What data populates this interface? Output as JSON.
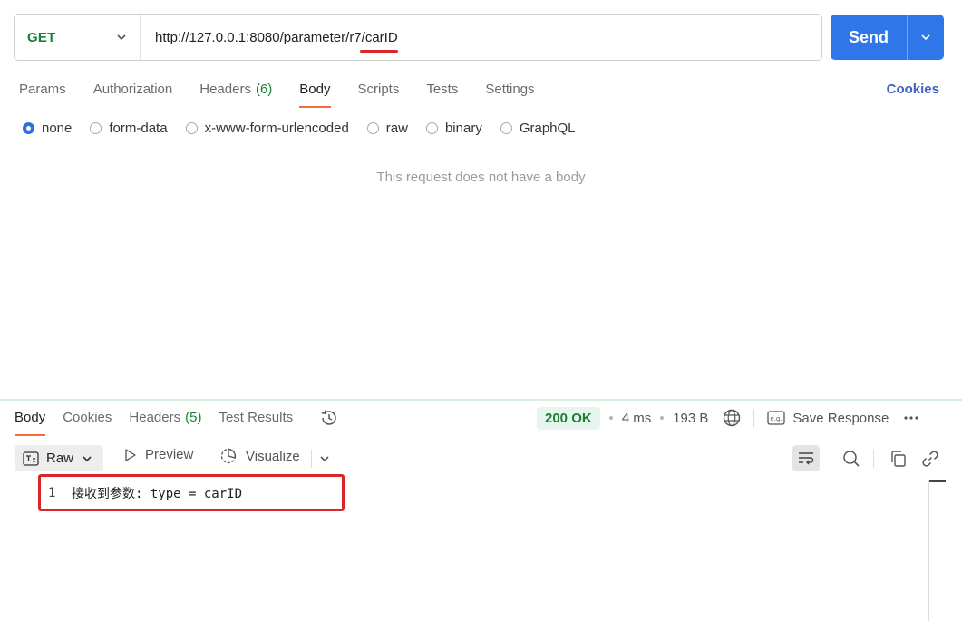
{
  "request": {
    "method": "GET",
    "url": "http://127.0.0.1:8080/parameter/r7/carID",
    "send_label": "Send"
  },
  "request_tabs": [
    {
      "label": "Params"
    },
    {
      "label": "Authorization"
    },
    {
      "label": "Headers",
      "count": "(6)"
    },
    {
      "label": "Body",
      "active": true
    },
    {
      "label": "Scripts"
    },
    {
      "label": "Tests"
    },
    {
      "label": "Settings"
    }
  ],
  "cookies_label": "Cookies",
  "body_types": [
    {
      "label": "none",
      "selected": true
    },
    {
      "label": "form-data"
    },
    {
      "label": "x-www-form-urlencoded"
    },
    {
      "label": "raw"
    },
    {
      "label": "binary"
    },
    {
      "label": "GraphQL"
    }
  ],
  "empty_body_message": "This request does not have a body",
  "response": {
    "tabs": [
      {
        "label": "Body",
        "active": true
      },
      {
        "label": "Cookies"
      },
      {
        "label": "Headers",
        "count": "(5)"
      },
      {
        "label": "Test Results"
      }
    ],
    "status": "200 OK",
    "time": "4 ms",
    "size": "193 B",
    "save_label": "Save Response",
    "view_mode": "Raw",
    "preview_label": "Preview",
    "visualize_label": "Visualize",
    "lines": [
      {
        "number": "1",
        "text": "接收到参数: type = carID"
      }
    ]
  },
  "colors": {
    "accent": "#f26b3a",
    "send": "#2f76e9",
    "status_ok": "#1a7f37",
    "highlight": "#d8262b"
  }
}
